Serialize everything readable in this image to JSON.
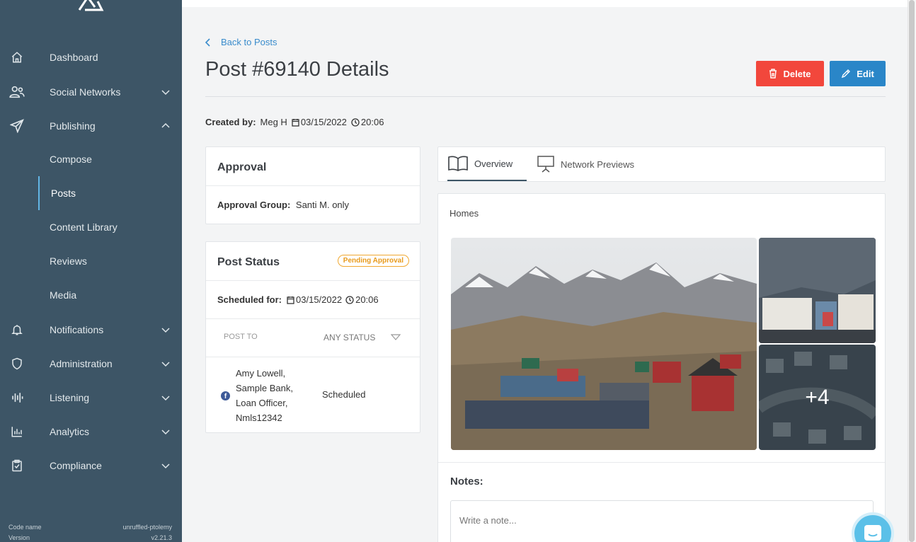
{
  "sidebar": {
    "items": [
      {
        "label": "Dashboard",
        "icon": "home-icon"
      },
      {
        "label": "Social Networks",
        "icon": "users-icon"
      },
      {
        "label": "Publishing",
        "icon": "paper-plane-icon"
      },
      {
        "label": "Notifications",
        "icon": "bell-icon"
      },
      {
        "label": "Administration",
        "icon": "shield-icon"
      },
      {
        "label": "Listening",
        "icon": "waveform-icon"
      },
      {
        "label": "Analytics",
        "icon": "bar-chart-icon"
      },
      {
        "label": "Compliance",
        "icon": "clipboard-check-icon"
      }
    ],
    "publishing_sub": [
      "Compose",
      "Posts",
      "Content Library",
      "Reviews",
      "Media"
    ],
    "code_name_label": "Code name",
    "code_name_value": "unruffled-ptolemy",
    "version_label": "Version",
    "version_value": "v2.21.3"
  },
  "header": {
    "back_label": "Back to Posts",
    "title": "Post #69140 Details",
    "delete_label": "Delete",
    "edit_label": "Edit"
  },
  "meta": {
    "created_by_label": "Created by:",
    "author": "Meg H",
    "date": "03/15/2022",
    "time": "20:06"
  },
  "approval": {
    "title": "Approval",
    "group_label": "Approval Group:",
    "group_value": "Santi M. only"
  },
  "post_status": {
    "title": "Post Status",
    "badge": "Pending Approval",
    "scheduled_label": "Scheduled for:",
    "date": "03/15/2022",
    "time": "20:06",
    "col_post_to": "POST TO",
    "col_status": "ANY STATUS",
    "row_account": [
      "Amy Lowell,",
      "Sample Bank,",
      "Loan Officer,",
      "Nmls12342"
    ],
    "row_status": "Scheduled"
  },
  "tabs": [
    {
      "label": "Overview"
    },
    {
      "label": "Network Previews"
    }
  ],
  "overview": {
    "caption": "Homes",
    "more_images": "+4",
    "notes_title": "Notes:",
    "note_placeholder": "Write a note..."
  },
  "colors": {
    "sidebar": "#3d5566",
    "delete": "#f2473c",
    "edit": "#2a86c8",
    "link": "#3a8ccc",
    "badge": "#e89a1c"
  }
}
